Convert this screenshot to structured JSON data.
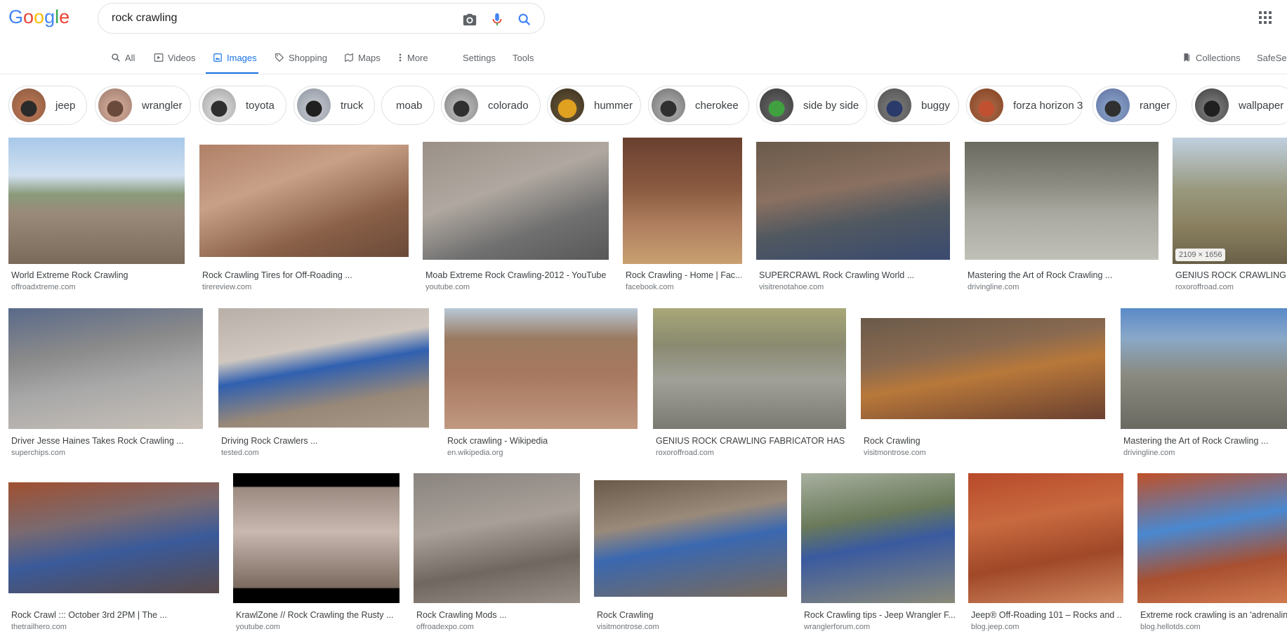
{
  "search": {
    "query": "rock crawling"
  },
  "tabs": [
    {
      "label": "All",
      "icon": "search-icon"
    },
    {
      "label": "Videos",
      "icon": "video-icon"
    },
    {
      "label": "Images",
      "icon": "image-icon"
    },
    {
      "label": "Shopping",
      "icon": "tag-icon"
    },
    {
      "label": "Maps",
      "icon": "map-icon"
    },
    {
      "label": "More",
      "icon": "more-icon"
    }
  ],
  "tools": {
    "settings": "Settings",
    "tools": "Tools",
    "collections": "Collections",
    "safesearch": "SafeSea"
  },
  "chips": [
    "jeep",
    "wrangler",
    "toyota",
    "truck",
    "moab",
    "colorado",
    "hummer",
    "cherokee",
    "side by side",
    "buggy",
    "forza horizon 3",
    "ranger",
    "wallpaper"
  ],
  "colors": {
    "accent": "#1a73e8",
    "text": "#3c4043",
    "muted": "#70757a"
  },
  "results": [
    {
      "title": "World Extreme Rock Crawling",
      "source": "offroadxtreme.com"
    },
    {
      "title": "Rock Crawling Tires for Off-Roading ...",
      "source": "tirereview.com"
    },
    {
      "title": "Moab Extreme Rock Crawling-2012 - YouTube",
      "source": "youtube.com"
    },
    {
      "title": "Rock Crawling - Home | Fac...",
      "source": "facebook.com"
    },
    {
      "title": "SUPERCRAWL Rock Crawling World ...",
      "source": "visitrenotahoe.com"
    },
    {
      "title": "Mastering the Art of Rock Crawling ...",
      "source": "drivingline.com"
    },
    {
      "title": "GENIUS ROCK CRAWLING FA",
      "source": "roxoroffroad.com",
      "badge": "2109 × 1656"
    },
    {
      "title": "Driver Jesse Haines Takes Rock Crawling ...",
      "source": "superchips.com"
    },
    {
      "title": "Driving Rock Crawlers ...",
      "source": "tested.com"
    },
    {
      "title": "Rock crawling - Wikipedia",
      "source": "en.wikipedia.org"
    },
    {
      "title": "GENIUS ROCK CRAWLING FABRICATOR HAS A ...",
      "source": "roxoroffroad.com"
    },
    {
      "title": "Rock Crawling",
      "source": "visitmontrose.com"
    },
    {
      "title": "Mastering the Art of Rock Crawling ...",
      "source": "drivingline.com"
    },
    {
      "title": "Rock Crawl ::: October 3rd 2PM | The ...",
      "source": "thetrailhero.com"
    },
    {
      "title": "KrawlZone // Rock Crawling the Rusty ...",
      "source": "youtube.com"
    },
    {
      "title": "Rock Crawling Mods ...",
      "source": "offroadexpo.com"
    },
    {
      "title": "Rock Crawling",
      "source": "visitmontrose.com"
    },
    {
      "title": "Rock Crawling tips - Jeep Wrangler F...",
      "source": "wranglerforum.com"
    },
    {
      "title": "Jeep® Off-Roading 101 – Rocks and ...",
      "source": "blog.jeep.com"
    },
    {
      "title": "Extreme rock crawling is an 'adrenalin",
      "source": "blog.hellotds.com"
    }
  ]
}
